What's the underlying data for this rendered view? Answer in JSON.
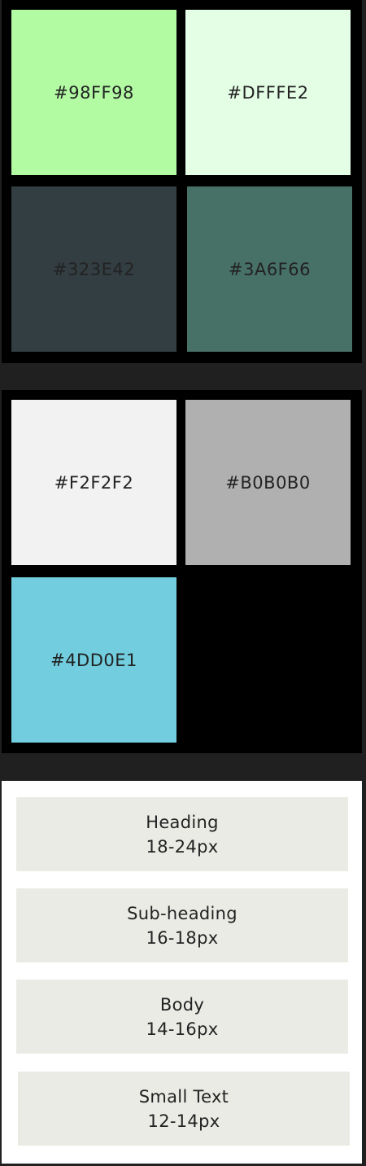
{
  "palettes": [
    {
      "swatches": [
        {
          "label": "#98FF98",
          "color": "#B2FBA3"
        },
        {
          "label": "#DFFFE2",
          "color": "#E4FEE6"
        },
        {
          "label": "#323E42",
          "color": "#333E42"
        },
        {
          "label": "#3A6F66",
          "color": "#477066"
        }
      ]
    },
    {
      "swatches": [
        {
          "label": "#F2F2F2",
          "color": "#F2F2F2"
        },
        {
          "label": "#B0B0B0",
          "color": "#B0B0B0"
        },
        {
          "label": "#4DD0E1",
          "color": "#72CDDE"
        }
      ]
    }
  ],
  "typography": [
    {
      "name": "Heading",
      "size": "18-24px"
    },
    {
      "name": "Sub-heading",
      "size": "16-18px"
    },
    {
      "name": "Body",
      "size": "14-16px"
    },
    {
      "name": "Small Text",
      "size": "12-14px"
    }
  ],
  "colors": {
    "page_bg": "#202020",
    "panel_bg": "#000000",
    "type_panel_bg": "#FFFFFF",
    "type_box_bg": "#EBEBE6"
  }
}
